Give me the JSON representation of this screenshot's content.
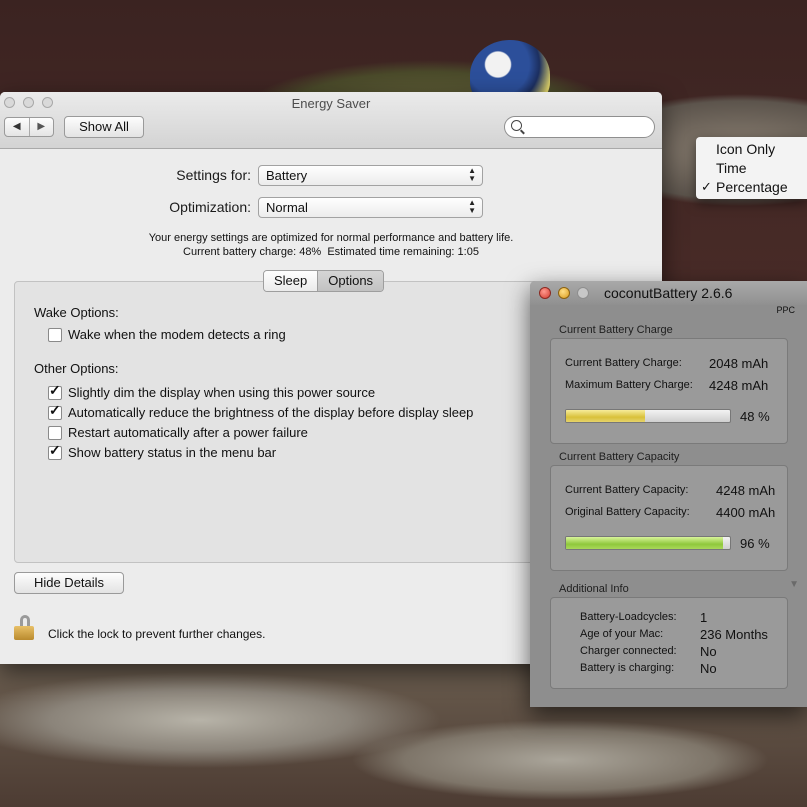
{
  "energy_saver": {
    "title": "Energy Saver",
    "nav_back": "◀",
    "nav_forward": "▶",
    "show_all": "Show All",
    "search_placeholder": "",
    "settings_for_label": "Settings for:",
    "settings_for_value": "Battery",
    "optimization_label": "Optimization:",
    "optimization_value": "Normal",
    "info_line1": "Your energy settings are optimized for normal performance and battery life.",
    "info_line2": "Current battery charge: 48%  Estimated time remaining: 1:05",
    "tabs": [
      {
        "label": "Sleep",
        "selected": false
      },
      {
        "label": "Options",
        "selected": true
      }
    ],
    "wake_options_label": "Wake Options:",
    "wake_options": [
      {
        "label": "Wake when the modem detects a ring",
        "checked": false
      }
    ],
    "other_options_label": "Other Options:",
    "other_options": [
      {
        "label": "Slightly dim the display when using this power source",
        "checked": true
      },
      {
        "label": "Automatically reduce the brightness of the display before display sleep",
        "checked": true
      },
      {
        "label": "Restart automatically after a power failure",
        "checked": false
      },
      {
        "label": "Show battery status in the menu bar",
        "checked": true
      }
    ],
    "hide_details": "Hide Details",
    "lock_text": "Click the lock to prevent further changes."
  },
  "battery_menu": {
    "items": [
      {
        "label": "Icon Only",
        "checked": false
      },
      {
        "label": "Time",
        "checked": false
      },
      {
        "label": "Percentage",
        "checked": true
      }
    ],
    "check_glyph": "✓"
  },
  "coconut": {
    "title": "coconutBattery 2.6.6",
    "arch": "PPC",
    "charge_group_title": "Current Battery Charge",
    "current_charge_label": "Current Battery Charge:",
    "current_charge_value": "2048 mAh",
    "max_charge_label": "Maximum Battery Charge:",
    "max_charge_value": "4248 mAh",
    "charge_percent_text": "48 %",
    "charge_fraction": 0.48,
    "capacity_group_title": "Current Battery Capacity",
    "current_capacity_label": "Current Battery Capacity:",
    "current_capacity_value": "4248 mAh",
    "original_capacity_label": "Original Battery Capacity:",
    "original_capacity_value": "4400 mAh",
    "capacity_percent_text": "96 %",
    "capacity_fraction": 0.96,
    "additional_title": "Additional Info",
    "info": [
      {
        "label": "Battery-Loadcycles:",
        "value": "1"
      },
      {
        "label": "Age of your Mac:",
        "value": "236 Months"
      },
      {
        "label": "Charger connected:",
        "value": "No"
      },
      {
        "label": "Battery is charging:",
        "value": "No"
      }
    ],
    "disclosure_glyph": "▼"
  }
}
